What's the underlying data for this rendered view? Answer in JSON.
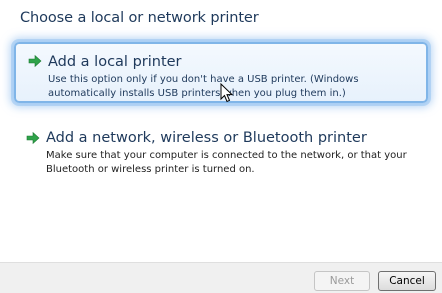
{
  "heading": "Choose a local or network printer",
  "options": [
    {
      "title": "Add a local printer",
      "description": "Use this option only if you don't have a USB printer. (Windows automatically installs USB printers when you plug them in.)",
      "icon": "green-arrow-icon",
      "selected": true
    },
    {
      "title": "Add a network, wireless or Bluetooth printer",
      "description": "Make sure that your computer is connected to the network, or that your Bluetooth or wireless printer is turned on.",
      "icon": "green-arrow-icon",
      "selected": false
    }
  ],
  "buttons": {
    "next": "Next",
    "cancel": "Cancel"
  },
  "colors": {
    "heading": "#1e395b",
    "selection_border": "#80b5e8",
    "arrow": "#2fa34a"
  }
}
